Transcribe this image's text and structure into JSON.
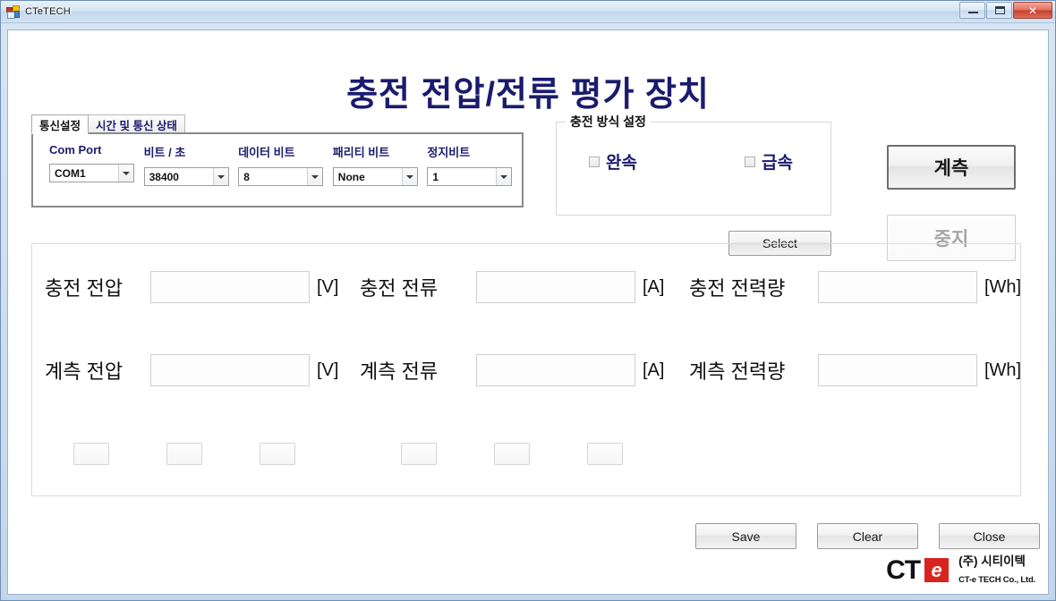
{
  "window": {
    "title": "CTeTECH",
    "icon": "app-form-icon",
    "controls": {
      "minimize": "minimize-icon",
      "maximize": "maximize-icon",
      "close": "✕"
    }
  },
  "page": {
    "title": "충전 전압/전류 평가 장치",
    "title_color": "#1b1b6e"
  },
  "tabs": [
    {
      "label": "통신설정",
      "active": true
    },
    {
      "label": "시간 및 통신 상태",
      "active": false
    }
  ],
  "serial_settings": [
    {
      "label": "Com Port",
      "value": "COM1"
    },
    {
      "label": "비트 / 초",
      "value": "38400"
    },
    {
      "label": "데이터 비트",
      "value": "8"
    },
    {
      "label": "패리티 비트",
      "value": "None"
    },
    {
      "label": "정지비트",
      "value": "1"
    }
  ],
  "charge_method": {
    "title": "충전 방식 설정",
    "options": [
      {
        "label": "완속",
        "checked": false
      },
      {
        "label": "급속",
        "checked": false
      }
    ],
    "select_button": "Select"
  },
  "control_buttons": {
    "measure": "계측",
    "stop": "중지",
    "stop_enabled": false
  },
  "readout": {
    "row1": [
      {
        "label": "충전 전압",
        "value": "",
        "unit": "[V]"
      },
      {
        "label": "충전 전류",
        "value": "",
        "unit": "[A]"
      },
      {
        "label": "충전 전력량",
        "value": "",
        "unit": "[Wh]"
      }
    ],
    "row2": [
      {
        "label": "계측 전압",
        "value": "",
        "unit": "[V]"
      },
      {
        "label": "계측 전류",
        "value": "",
        "unit": "[A]"
      },
      {
        "label": "계측 전력량",
        "value": "",
        "unit": "[Wh]"
      }
    ],
    "indicators": [
      "",
      "",
      "",
      "",
      "",
      ""
    ]
  },
  "bottom_buttons": [
    {
      "label": "Save"
    },
    {
      "label": "Clear"
    },
    {
      "label": "Close"
    }
  ],
  "logo": {
    "mark": "CT",
    "badge": "e",
    "company_kr": "(주) 시티이텍",
    "company_en": "CT-e TECH Co., Ltd.",
    "badge_color": "#d7241f"
  }
}
